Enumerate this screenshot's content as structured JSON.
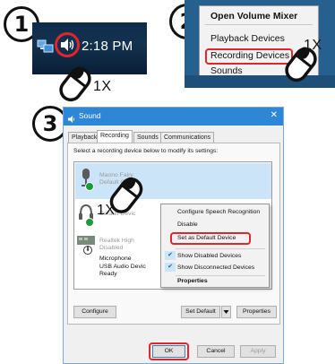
{
  "steps": [
    "1",
    "2",
    "3"
  ],
  "taskbar": {
    "time": "2:18 PM",
    "icons": [
      "network-icon",
      "speaker-icon"
    ]
  },
  "tray_menu": {
    "items": [
      "Open Volume Mixer",
      "Playback Devices",
      "Recording Devices",
      "Sounds"
    ],
    "highlighted": "Recording Devices"
  },
  "click_counts": [
    "1X",
    "1X",
    "1X"
  ],
  "dialog": {
    "title": "Sound",
    "close": "✕",
    "tabs": [
      "Playback",
      "Recording",
      "Sounds",
      "Communications"
    ],
    "active_tab": "Recording",
    "instruction": "Select a recording device below to modify its settings:",
    "devices": [
      {
        "line1": "Maono Fairy",
        "line2": "Default Comm"
      },
      {
        "line1": "",
        "line2": "Default Devic"
      },
      {
        "line1": "Realtek High",
        "line2": "Disabled"
      },
      {
        "line1": "Microphone",
        "line2": "USB Audio Devic",
        "line3": "Ready"
      }
    ],
    "context_menu": {
      "items": [
        "Configure Speech Recognition",
        "Disable",
        "Set as Default Device",
        "Show Disabled Devices",
        "Show Disconnected Devices",
        "Properties"
      ],
      "checked": [
        "Show Disabled Devices",
        "Show Disconnected Devices"
      ],
      "highlighted": "Set as Default Device"
    },
    "buttons": {
      "configure": "Configure",
      "set_default": "Set Default",
      "properties": "Properties",
      "ok": "OK",
      "cancel": "Cancel",
      "apply": "Apply"
    }
  },
  "colors": {
    "highlight": "#e0262c",
    "titlebar": "#2e87d6",
    "selection": "#cce4f7"
  }
}
